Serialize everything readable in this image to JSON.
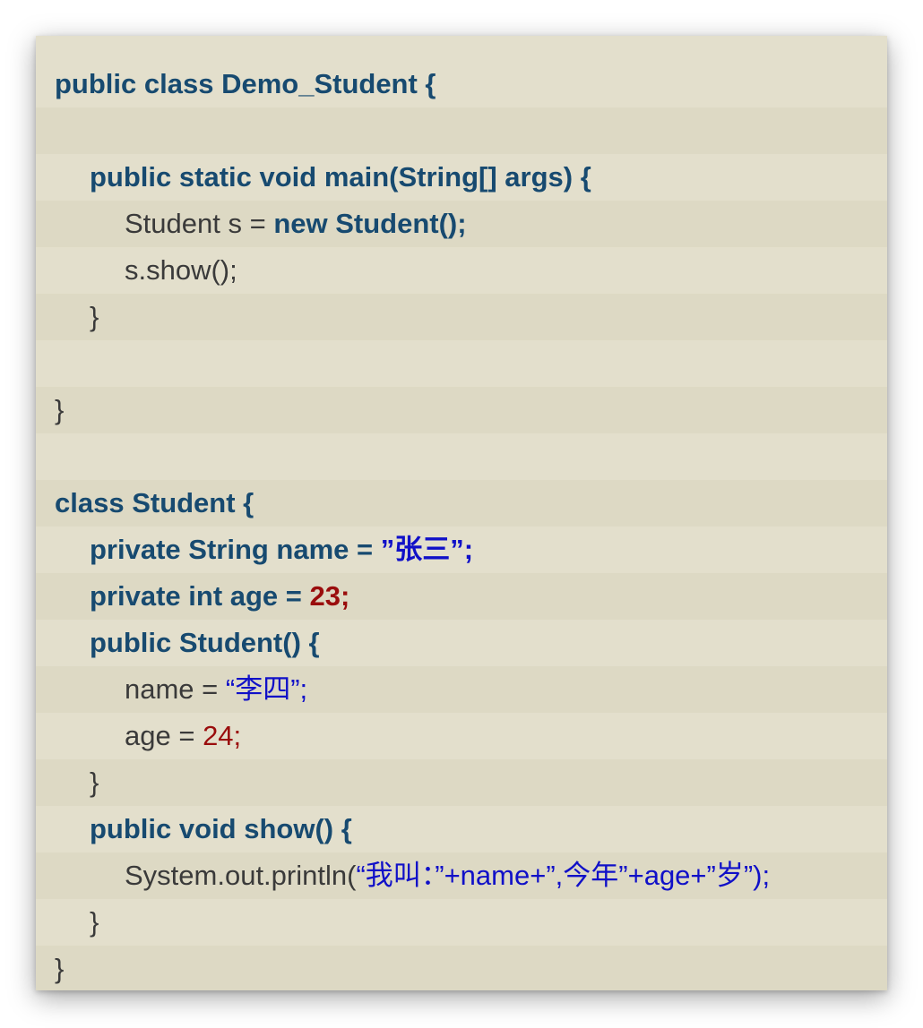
{
  "code": {
    "language": "java",
    "lines": [
      {
        "indent": 0,
        "tokens": [
          {
            "t": "public class Demo_Student {",
            "s": "kw"
          }
        ]
      },
      {
        "indent": 0,
        "tokens": []
      },
      {
        "indent": 1,
        "tokens": [
          {
            "t": "public static void main(String[] args) {",
            "s": "kw"
          }
        ]
      },
      {
        "indent": 2,
        "tokens": [
          {
            "t": "Student s = ",
            "s": "plain"
          },
          {
            "t": "new Student();",
            "s": "kw"
          }
        ]
      },
      {
        "indent": 2,
        "tokens": [
          {
            "t": "s.show();",
            "s": "plain"
          }
        ]
      },
      {
        "indent": 1,
        "tokens": [
          {
            "t": "}",
            "s": "plain"
          }
        ]
      },
      {
        "indent": 0,
        "tokens": []
      },
      {
        "indent": 0,
        "tokens": [
          {
            "t": "}",
            "s": "plain"
          }
        ]
      },
      {
        "indent": 0,
        "tokens": []
      },
      {
        "indent": 0,
        "tokens": [
          {
            "t": "class Student {",
            "s": "kw"
          }
        ]
      },
      {
        "indent": 1,
        "tokens": [
          {
            "t": "private String name = ",
            "s": "kw"
          },
          {
            "t": "”张三”;",
            "s": "strb"
          }
        ]
      },
      {
        "indent": 1,
        "tokens": [
          {
            "t": "private int age = ",
            "s": "kw"
          },
          {
            "t": "23;",
            "s": "numb"
          }
        ]
      },
      {
        "indent": 1,
        "tokens": [
          {
            "t": "public Student() {",
            "s": "kw"
          }
        ]
      },
      {
        "indent": 2,
        "tokens": [
          {
            "t": "name = ",
            "s": "plain"
          },
          {
            "t": "“李四”;",
            "s": "str"
          }
        ]
      },
      {
        "indent": 2,
        "tokens": [
          {
            "t": "age = ",
            "s": "plain"
          },
          {
            "t": "24;",
            "s": "num"
          }
        ]
      },
      {
        "indent": 1,
        "tokens": [
          {
            "t": "}",
            "s": "plain"
          }
        ]
      },
      {
        "indent": 1,
        "tokens": [
          {
            "t": "public void show() {",
            "s": "kw"
          }
        ]
      },
      {
        "indent": 2,
        "tokens": [
          {
            "t": "System.out.println(",
            "s": "plain"
          },
          {
            "t": "“我叫：”+name+”,今年”+age+”岁”);",
            "s": "str"
          }
        ]
      },
      {
        "indent": 1,
        "tokens": [
          {
            "t": "}",
            "s": "plain"
          }
        ]
      },
      {
        "indent": 0,
        "tokens": [
          {
            "t": "}",
            "s": "plain"
          }
        ]
      }
    ]
  },
  "colors": {
    "row_odd": "#e3dfcc",
    "row_even": "#ddd9c4",
    "keyword": "#174a70",
    "plain": "#3a3a3a",
    "string": "#1010c8",
    "number": "#9a0d0d"
  }
}
